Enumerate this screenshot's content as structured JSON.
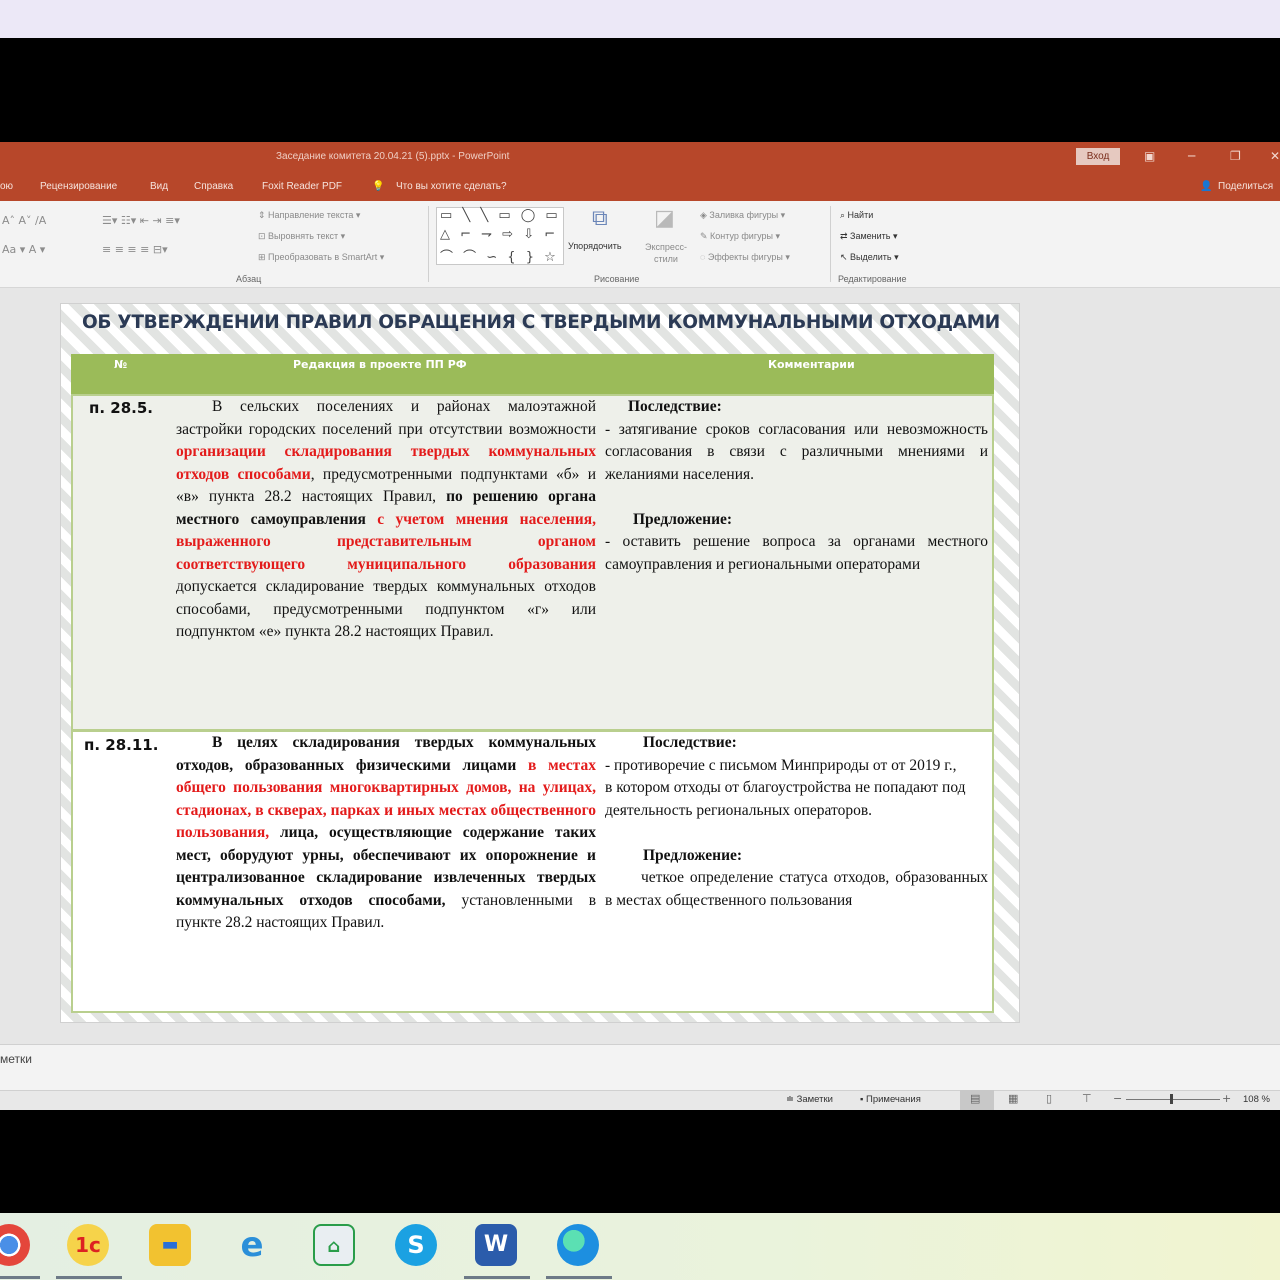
{
  "window": {
    "title": "Заседание комитета 20.04.21 (5).pptx  -  PowerPoint",
    "login_label": "Вход",
    "share_label": "Поделиться"
  },
  "menu": {
    "items": [
      "ою",
      "Рецензирование",
      "Вид",
      "Справка",
      "Foxit Reader PDF"
    ],
    "tell_me": "Что вы хотите сделать?"
  },
  "ribbon": {
    "paragraph_group": "Абзац",
    "text_direction": "Направление текста",
    "align_text": "Выровнять текст",
    "smartart": "Преобразовать в SmartArt",
    "arrange": "Упорядочить",
    "quick_styles": "Экспресс-стили",
    "drawing_group": "Рисование",
    "shape_fill": "Заливка фигуры",
    "shape_outline": "Контур фигуры",
    "shape_effects": "Эффекты фигуры",
    "find": "Найти",
    "replace": "Заменить",
    "select": "Выделить",
    "editing_group": "Редактирование"
  },
  "slide": {
    "title": "ОБ УТВЕРЖДЕНИИ ПРАВИЛ ОБРАЩЕНИЯ С ТВЕРДЫМИ КОММУНАЛЬНЫМИ ОТХОДАМИ",
    "headers": {
      "num": "№",
      "edition": "Редакция в проекте ПП РФ",
      "comments": "Комментарии"
    },
    "rows": [
      {
        "num": "п. 28.5.",
        "edition": {
          "a": "В сельских поселениях и районах малоэтажной застройки городских поселений при отсутствии возможности ",
          "b": "организации складирования твердых коммунальных отходов способами",
          "c": ", предусмотренными подпунктами «б» и «в» пункта 28.2 настоящих Правил, ",
          "d": "по решению органа местного самоуправления ",
          "e": "с учетом мнения населения, выраженного представительным органом соответствующего муниципального образования",
          "f": " допускается складирование твердых коммунальных отходов способами, предусмотренными подпунктом «г» или подпунктом «е» пункта 28.2 настоящих Правил."
        },
        "comment": {
          "consequence_label": "Последствие:",
          "consequence_text": "- затягивание сроков согласования или невозможность согласования в связи с различными мнениями и желаниями населения.",
          "proposal_label": "Предложение:",
          "proposal_text": "- оставить решение вопроса за органами местного самоуправления и региональными операторами"
        }
      },
      {
        "num": "п. 28.11.",
        "edition": {
          "a": "В целях складирования твердых коммунальных отходов, образованных физическими лицами ",
          "b": "в местах общего пользования многоквартирных домов, на улицах, стадионах, в скверах, парках и иных местах общественного пользования,",
          "c": " лица, осуществляющие содержание таких мест, оборудуют урны, обеспечивают их опорожнение и централизованное складирование извлеченных твердых коммунальных отходов способами, ",
          "d": "установленными в пункте 28.2 настоящих Правил."
        },
        "comment": {
          "consequence_label": "Последствие:",
          "consequence_text": "- противоречие с письмом Минприроды от от 2019 г., в котором отходы от благоустройства не попадают под деятельность региональных операторов.",
          "proposal_label": "Предложение:",
          "proposal_text": "четкое определение статуса отходов, образованных в местах общественного пользования"
        }
      }
    ]
  },
  "notes_label": "метки",
  "status": {
    "notes": "Заметки",
    "comments": "Примечания",
    "zoom": "108 %",
    "zoom_fraction": 0.48
  },
  "taskbar": {
    "apps": [
      "chrome-icon",
      "1c-icon",
      "file-explorer-icon",
      "internet-explorer-icon",
      "scanner-icon",
      "skype-icon",
      "word-icon",
      "edge-icon"
    ]
  }
}
